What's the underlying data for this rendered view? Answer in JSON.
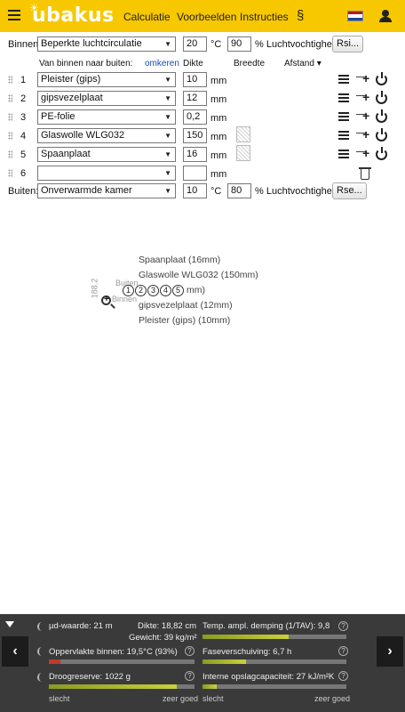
{
  "header": {
    "logo_text": "ubakus",
    "nav": [
      "Calculatie",
      "Voorbeelden",
      "Instructies",
      "§"
    ],
    "flag_colors": [
      "#ae1c28",
      "#ffffff",
      "#21468b"
    ]
  },
  "inside": {
    "label": "Binnen:",
    "type": "Beperkte luchtcirculatie",
    "temp": "20",
    "temp_unit": "°C",
    "rh": "90",
    "rh_label": "% Luchtvochtigheid",
    "rsi_button": "Rsi..."
  },
  "table_header": {
    "direction": "Van binnen naar buiten:",
    "reverse_link": "omkeren",
    "thickness": "Dikte",
    "width": "Breedte",
    "distance": "Afstand ▾"
  },
  "layers": [
    {
      "num": "1",
      "material": "Pleister (gips)",
      "thickness": "10",
      "unit": "mm",
      "wool_icon": false
    },
    {
      "num": "2",
      "material": "gipsvezelplaat",
      "thickness": "12",
      "unit": "mm",
      "wool_icon": false
    },
    {
      "num": "3",
      "material": "PE-folie",
      "thickness": "0,2",
      "unit": "mm",
      "wool_icon": false
    },
    {
      "num": "4",
      "material": "Glaswolle WLG032",
      "thickness": "150",
      "unit": "mm",
      "wool_icon": true
    },
    {
      "num": "5",
      "material": "Spaanplaat",
      "thickness": "16",
      "unit": "mm",
      "wool_icon": true
    },
    {
      "num": "6",
      "material": "",
      "thickness": "",
      "unit": "mm",
      "wool_icon": false
    }
  ],
  "outside": {
    "label": "Buiten:",
    "type": "Onverwarmde kamer",
    "temp": "10",
    "temp_unit": "°C",
    "rh": "80",
    "rh_label": "% Luchtvochtigheid",
    "rse_button": "Rse..."
  },
  "diagram": {
    "layer_labels": [
      "Spaanplaat (16mm)",
      "Glaswolle WLG032 (150mm)",
      "mm)",
      "gipsvezelplaat (12mm)",
      "Pleister (gips) (10mm)"
    ],
    "circles": [
      "1",
      "2",
      "3",
      "4",
      "5"
    ],
    "outside_label": "Buiten",
    "inside_label": "Binnen",
    "scale_label": "188.2"
  },
  "results": {
    "sd_value": "µd-waarde: 21 m",
    "thickness": "Dikte: 18,82 cm",
    "weight": "Gewicht: 39 kg/m²",
    "temp_damping": "Temp. ampl. demping (1/TAV): 9,8",
    "surface_inside": "Oppervlakte binnen: 19,5°C (93%)",
    "phase_shift": "Faseverschuiving: 6,7 h",
    "drying_reserve": "Droogreserve: 1022 g",
    "heat_capacity": "Interne opslagcapaciteit: 27 kJ/m²K",
    "bad": "slecht",
    "very_good": "zeer goed",
    "help": "?",
    "prev": "‹",
    "next": "›",
    "bars": {
      "temp_damping": 0.6,
      "surface_inside": 0.08,
      "phase_shift": 0.3,
      "drying_reserve": 0.88,
      "heat_capacity": 0.1
    }
  }
}
